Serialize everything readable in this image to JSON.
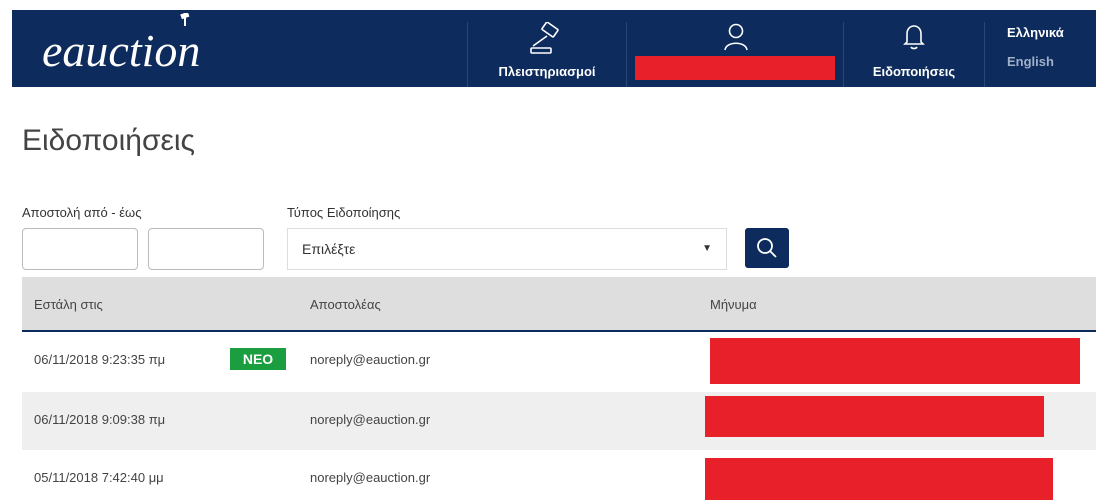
{
  "header": {
    "logo_text": "eauction",
    "brand_color": "#0d2b5c",
    "nav": {
      "auctions_label": "Πλειστηριασμοί",
      "notifications_label": "Ειδοποιήσεις"
    },
    "languages": {
      "greek": "Ελληνικά",
      "english": "English"
    }
  },
  "page": {
    "title": "Ειδοποιήσεις"
  },
  "filters": {
    "date_range_label": "Αποστολή από - έως",
    "date_from_value": "",
    "date_to_value": "",
    "type_label": "Τύπος Ειδοποίησης",
    "type_selected": "Επιλέξτε"
  },
  "table": {
    "headers": {
      "sent_at": "Εστάλη στις",
      "sender": "Αποστολέας",
      "message": "Μήνυμα"
    },
    "new_badge": "ΝΕΟ",
    "rows": [
      {
        "sent_at": "06/11/2018 9:23:35 πμ",
        "sender": "noreply@eauction.gr",
        "is_new": true
      },
      {
        "sent_at": "06/11/2018 9:09:38 πμ",
        "sender": "noreply@eauction.gr",
        "is_new": false
      },
      {
        "sent_at": "05/11/2018 7:42:40 μμ",
        "sender": "noreply@eauction.gr",
        "is_new": false
      }
    ]
  },
  "colors": {
    "redaction": "#e8202a",
    "new_badge": "#1a9e3f"
  }
}
